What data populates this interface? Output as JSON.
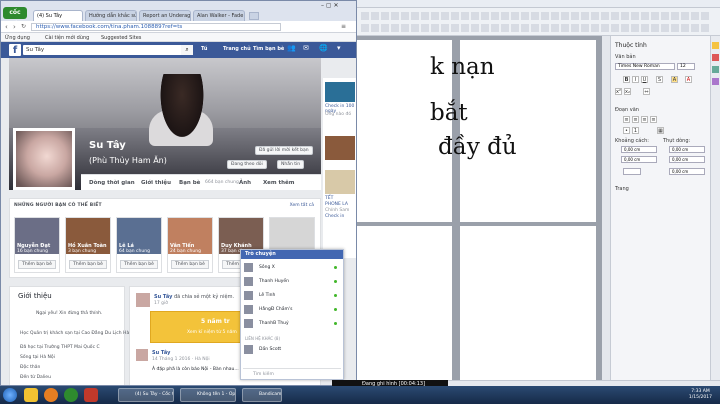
{
  "writer": {
    "title": "Không tên 1 - OpenOffice Writer",
    "doc_lines": [
      "k nạn",
      "bắt",
      "đầy đủ"
    ],
    "sidebar": {
      "title": "Thuộc tính",
      "sec_text": "Văn bản",
      "font_name": "Times New Roman",
      "font_size": "12",
      "sec_paragraph": "Đoạn văn",
      "spacing_label": "Khoảng cách:",
      "indent_label": "Thụt dòng:",
      "sec_page": "Trang",
      "spacing_val1": "0,00 cm",
      "spacing_val2": "0,00 cm",
      "indent_val1": "0,00 cm",
      "indent_val2": "0,00 cm",
      "indent_val3": "0,00 cm"
    }
  },
  "browser": {
    "logo": "cốc cốc",
    "tabs": [
      {
        "label": "(4) Su Tây"
      },
      {
        "label": "Hướng dẫn khắc sửa h"
      },
      {
        "label": "Report an Underage Ch"
      },
      {
        "label": "Alan Walker - Fade"
      }
    ],
    "url": "https://www.facebook.com/tina.pham.1088897ref=ts",
    "bookmarks": [
      "Ứng dụng",
      "Cài tiện mới dùng",
      "Suggested Sites"
    ]
  },
  "facebook": {
    "search_value": "Su Tây",
    "nav": [
      "Tú",
      "Trang chủ",
      "Tìm bạn bè"
    ],
    "profile": {
      "name": "Su Tây",
      "nickname": "(Phù Thủy Ham Ăn)",
      "btn_friend_request": "Đã gửi lời mời kết bạn",
      "btn_following": "Đang theo dõi",
      "btn_message": "Nhắn tin"
    },
    "profile_nav": [
      "Dòng thời gian",
      "Giới thiệu",
      "Bạn bè",
      "Ảnh",
      "Xem thêm"
    ],
    "friends_count": "664 bạn chung",
    "pymk": {
      "title": "NHỮNG NGƯỜI BẠN CÓ THỂ BIẾT",
      "see_all": "Xem tất cả",
      "cards": [
        {
          "name": "Nguyễn Đạt",
          "mutual": "16 bạn chung",
          "add": "Thêm bạn bè",
          "color": "#6b6e86"
        },
        {
          "name": "Hồ Xuân Toàn",
          "mutual": "3 bạn chung",
          "add": "Thêm bạn bè",
          "color": "#8a5a3c"
        },
        {
          "name": "Lê Lá",
          "mutual": "64 bạn chung",
          "add": "Thêm bạn bè",
          "color": "#5a6f92"
        },
        {
          "name": "Vân Tiến",
          "mutual": "24 bạn chung",
          "add": "Thêm bạn bè",
          "color": "#c08060"
        },
        {
          "name": "Duy Khánh",
          "mutual": "37 bạn chung",
          "add": "Thêm bạn bè",
          "color": "#7b5e52"
        },
        {
          "name": "",
          "mutual": "",
          "add": "Thêm bạn bè",
          "color": "#d6d6d6"
        }
      ]
    },
    "intro": {
      "title": "Giới thiệu",
      "quote": "Ngại yêu! Xin đừng thả thính.",
      "lines": [
        "Học Quản trị khách sạn tại Cao Đẳng Du Lịch Hà Nội",
        "Đã học tại Trường THPT Mai Quốc C",
        "Sống tại Hà Nội",
        "Độc thân",
        "Đến từ Dalieu"
      ]
    },
    "post": {
      "author": "Su Tây",
      "action": "đã chia sẻ một kỷ niệm.",
      "time": "17 giờ",
      "memory_title": "5 năm tr",
      "memory_sub": "Xem kỉ niệm từ 5 năm",
      "sub_author": "Su Tây",
      "sub_date": "14 Tháng 1 2016 · Hà Nội",
      "text": "À đặp phã là còn báo Nội - Bàn nhau..."
    },
    "ads": [
      "Check in 100 ngày",
      "Ông nào đó",
      "TẾT",
      "PHONE LA",
      "Chính Sam",
      "Check in"
    ]
  },
  "chat": {
    "header": "Trò chuyện",
    "contacts": [
      "Sông X",
      "Thanh Huyền",
      "Lê Tình",
      "HằngĐ Chầm's",
      "ThanhB Thuý",
      "Dần Scott"
    ],
    "other_label": "LIÊN HỆ KHÁC (8)",
    "search": "Tìm kiếm"
  },
  "recorder": {
    "label": "Đang ghi hình [00:04:13]"
  },
  "taskbar": {
    "tasks": [
      "(4) Su Tây - Cốc C...",
      "Không tên 1 - Op...",
      "Bandicam"
    ],
    "time": "7:33 AM",
    "date": "1/15/2017"
  },
  "colors": {
    "facebook_blue": "#3b5998",
    "chat_header": "#4267b2",
    "online": "#42b72a"
  }
}
